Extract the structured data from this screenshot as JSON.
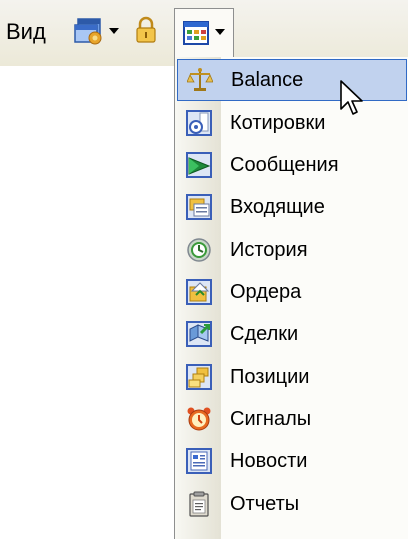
{
  "toolbar": {
    "view_label": "Вид",
    "icons": [
      "windows-icon",
      "lock-icon",
      "grid-icon"
    ]
  },
  "menu": {
    "items": [
      {
        "label": "Balance",
        "icon": "scales-icon",
        "highlighted": true
      },
      {
        "label": "Котировки",
        "icon": "quotes-icon"
      },
      {
        "label": "Сообщения",
        "icon": "messages-icon"
      },
      {
        "label": "Входящие",
        "icon": "inbox-icon"
      },
      {
        "label": "История",
        "icon": "history-icon"
      },
      {
        "label": "Ордера",
        "icon": "orders-icon"
      },
      {
        "label": "Сделки",
        "icon": "deals-icon"
      },
      {
        "label": "Позиции",
        "icon": "positions-icon"
      },
      {
        "label": "Сигналы",
        "icon": "alarm-clock-icon"
      },
      {
        "label": "Новости",
        "icon": "news-icon"
      },
      {
        "label": "Отчеты",
        "icon": "reports-icon"
      }
    ]
  },
  "colors": {
    "highlight_bg": "#c1d2ee",
    "highlight_border": "#316ac5"
  }
}
